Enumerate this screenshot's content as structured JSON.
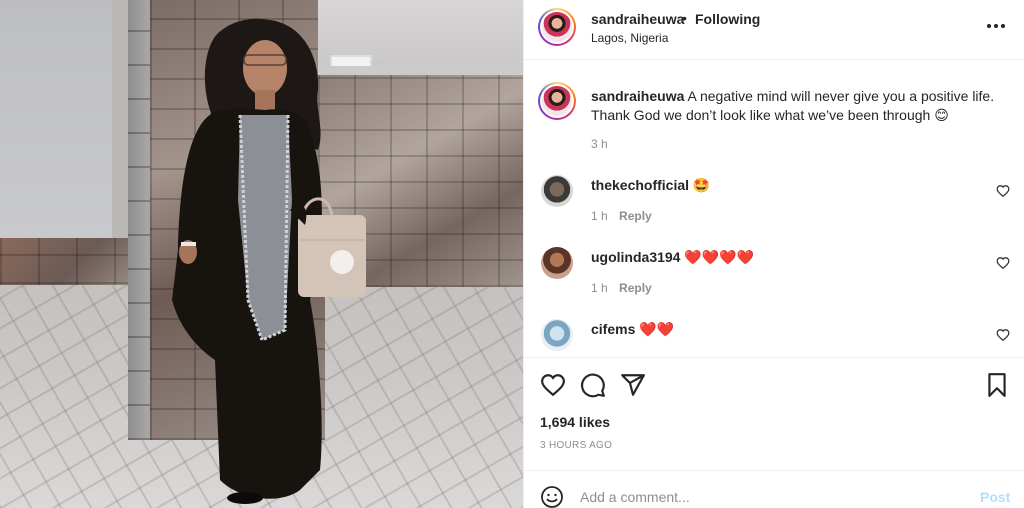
{
  "post": {
    "username": "sandraiheuwa",
    "follow_status": "Following",
    "separator": "•",
    "location": "Lagos, Nigeria"
  },
  "caption": {
    "username": "sandraiheuwa",
    "text": "A negative mind will never give you a positive life. Thank God we don’t look like what we’ve been through 😊",
    "time": "3 h"
  },
  "comments": [
    {
      "username": "thekechofficial",
      "text": "🤩",
      "time": "1 h",
      "reply_label": "Reply"
    },
    {
      "username": "ugolinda3194",
      "text": "❤️❤️❤️❤️",
      "time": "1 h",
      "reply_label": "Reply"
    },
    {
      "username": "cifems",
      "text": "❤️❤️"
    }
  ],
  "engagement": {
    "likes": "1,694 likes",
    "posted": "3 HOURS AGO"
  },
  "composer": {
    "placeholder": "Add a comment...",
    "post_label": "Post"
  },
  "icons": {
    "more": "more-options-icon",
    "like": "heart-icon",
    "comment": "comment-bubble-icon",
    "share": "send-icon",
    "save": "bookmark-icon",
    "emoji": "smiley-icon"
  }
}
